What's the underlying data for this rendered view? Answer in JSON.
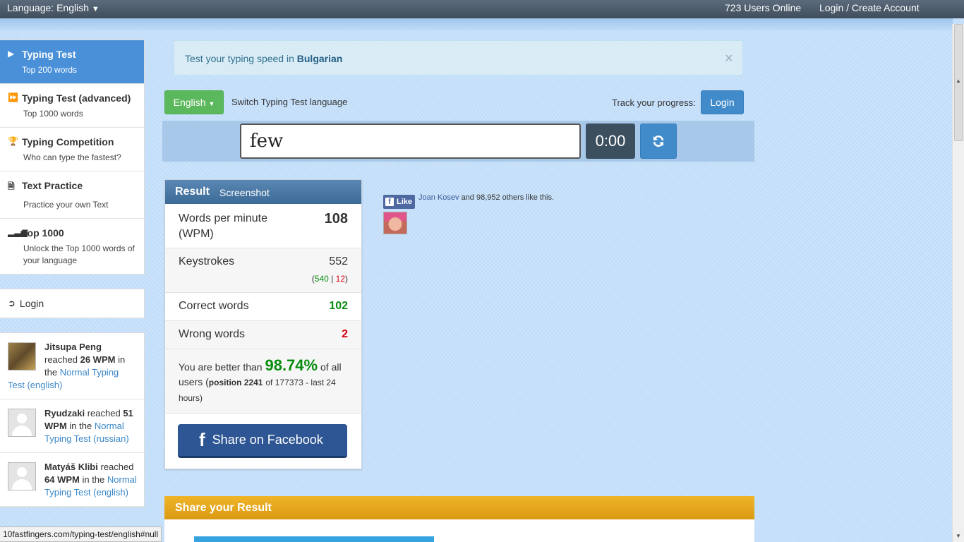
{
  "topbar": {
    "language": "Language: English",
    "users_online": "723 Users Online",
    "account": "Login / Create Account"
  },
  "sidebar": {
    "items": [
      {
        "title": "Typing Test",
        "sub": "Top 200 words",
        "icon": "play-icon",
        "active": true
      },
      {
        "title": "Typing Test (advanced)",
        "sub": "Top 1000 words",
        "icon": "fast-forward-icon"
      },
      {
        "title": "Typing Competition",
        "sub": "Who can type the fastest?",
        "icon": "trophy-icon"
      },
      {
        "title": "Text Practice",
        "sub": "Practice your own Text",
        "icon": "document-icon"
      },
      {
        "title": "Top 1000",
        "sub": "Unlock the Top 1000 words of your language",
        "icon": "signal-bars-icon"
      }
    ],
    "login": "Login"
  },
  "activity": [
    {
      "name": "Jitsupa Peng",
      "reached": "reached",
      "wpm": "26 WPM",
      "in_the": "in the",
      "link": "Normal Typing Test (english)"
    },
    {
      "name": "Ryudzaki",
      "reached": "reached",
      "wpm": "51 WPM",
      "in_the": "in the",
      "link": "Normal Typing Test (russian)"
    },
    {
      "name": "Matyáš Klibi",
      "reached": "reached",
      "wpm": "64 WPM",
      "in_the": "in the",
      "link": "Normal Typing Test (english)"
    }
  ],
  "alert": {
    "text": "Test your typing speed in",
    "language": "Bulgarian",
    "close": "×"
  },
  "controls": {
    "language_button": "English",
    "switch_label": "Switch Typing Test language",
    "track_label": "Track your progress:",
    "login_button": "Login"
  },
  "test": {
    "current_word": "few",
    "timer": "0:00"
  },
  "result": {
    "title": "Result",
    "screenshot": "Screenshot",
    "wpm_label": "Words per minute (WPM)",
    "wpm_value": "108",
    "keystrokes_label": "Keystrokes",
    "keystrokes_value": "552",
    "keystrokes_correct": "540",
    "keystrokes_sep": "|",
    "keystrokes_wrong": "12",
    "correct_label": "Correct words",
    "correct_value": "102",
    "wrong_label": "Wrong words",
    "wrong_value": "2",
    "better_prefix": "You are better than",
    "better_pct": "98.74%",
    "better_of": "of",
    "better_all": "all users (",
    "position": "position 2241",
    "position_rest": "of 177373 - last 24 hours)",
    "share_button": "Share on Facebook"
  },
  "like_widget": {
    "like": "Like",
    "friend": "Joan Kosev",
    "rest": "and 98,952 others like this."
  },
  "share_result": {
    "title": "Share your Result"
  },
  "status_url": "10fastfingers.com/typing-test/english#null",
  "colors": {
    "accent_blue": "#428bca",
    "green_button": "#5cb85c",
    "correct_green": "#078c0e",
    "wrong_red": "#d9000b",
    "share_orange": "#f0b429",
    "facebook_blue": "#2e5694"
  }
}
